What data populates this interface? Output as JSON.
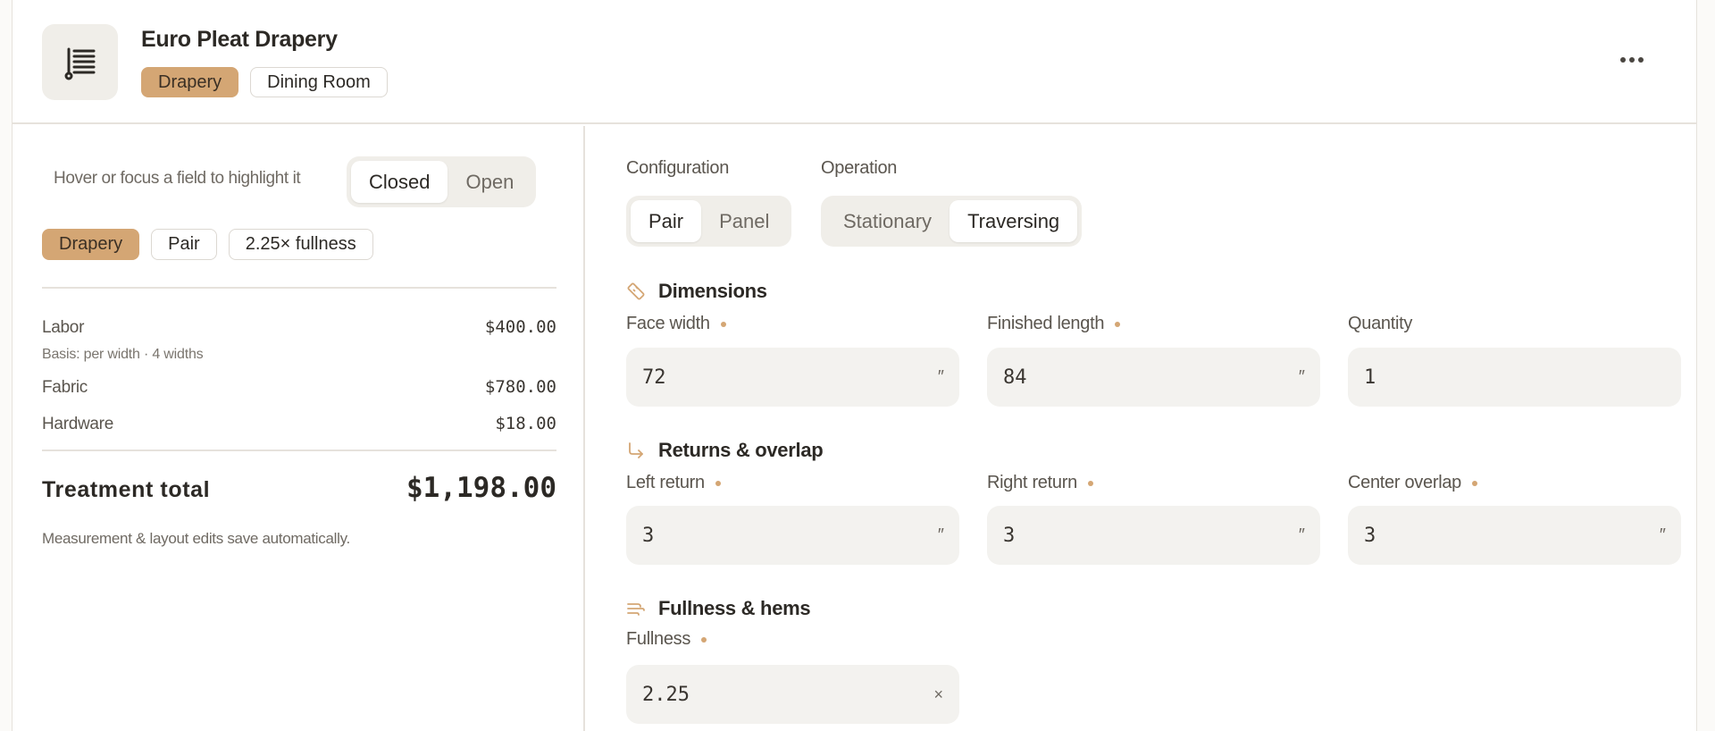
{
  "header": {
    "title": "Euro Pleat Drapery",
    "tags": [
      "Drapery",
      "Dining Room"
    ],
    "more_label": "More options"
  },
  "summary": {
    "hint": "Hover or focus a field to highlight it",
    "view_toggle": {
      "options": [
        "Closed",
        "Open"
      ],
      "selected": "Closed"
    },
    "chips": [
      "Drapery",
      "Pair",
      "2.25× fullness"
    ],
    "lines": [
      {
        "label": "Labor",
        "value": "$400.00",
        "sub": "Basis: per width · 4 widths"
      },
      {
        "label": "Fabric",
        "value": "$780.00"
      },
      {
        "label": "Hardware",
        "value": "$18.00"
      }
    ],
    "total_label": "Treatment total",
    "total_value": "$1,198.00",
    "note": "Measurement & layout edits save automatically."
  },
  "config": {
    "configuration": {
      "label": "Configuration",
      "options": [
        "Pair",
        "Panel"
      ],
      "selected": "Pair"
    },
    "operation": {
      "label": "Operation",
      "options": [
        "Stationary",
        "Traversing"
      ],
      "selected": "Traversing"
    }
  },
  "sections": {
    "dimensions": {
      "title": "Dimensions",
      "fields": [
        {
          "label": "Face width",
          "value": "72",
          "unit": "″"
        },
        {
          "label": "Finished length",
          "value": "84",
          "unit": "″"
        },
        {
          "label": "Quantity",
          "value": "1",
          "unit": ""
        }
      ]
    },
    "returns": {
      "title": "Returns & overlap",
      "fields": [
        {
          "label": "Left return",
          "value": "3",
          "unit": "″"
        },
        {
          "label": "Right return",
          "value": "3",
          "unit": "″"
        },
        {
          "label": "Center overlap",
          "value": "3",
          "unit": "″"
        }
      ]
    },
    "fullness": {
      "title": "Fullness & hems",
      "fields": [
        {
          "label": "Fullness",
          "value": "2.25",
          "unit": "×"
        }
      ]
    }
  },
  "colors": {
    "accent": "#d4a674",
    "field_bg": "#f3f2ef",
    "border": "#e6e2dc"
  }
}
